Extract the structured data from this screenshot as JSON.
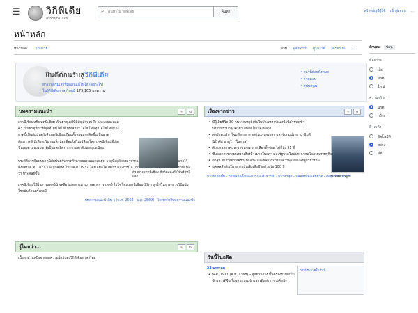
{
  "header": {
    "menu_icon": "menu-icon",
    "logo_title": "วิกิพีเดีย",
    "logo_tagline": "สารานุกรมเสรี",
    "search_placeholder": "ค้นหาใน วิกิพีเดีย",
    "search_button": "ค้นหา",
    "user_links": [
      "สร้างบัญชีผู้ใช้",
      "เข้าสู่ระบบ"
    ],
    "more_icon": "..."
  },
  "page": {
    "title": "หน้าหลัก",
    "tabs_left": [
      "หน้าหลัก",
      "อภิปราย"
    ],
    "tabs_right": [
      "อ่าน",
      "ดูต้นฉบับ",
      "ดูประวัติ",
      "เครื่องมือ"
    ]
  },
  "sidebar": {
    "title": "ลักษณะ",
    "hide": "ซ่อน",
    "groups": [
      {
        "label": "ข้อความ",
        "options": [
          "เล็ก",
          "ปกติ",
          "ใหญ่"
        ],
        "selected": 1
      },
      {
        "label": "ความกว้าง",
        "options": [
          "ปกติ",
          "กว้าง"
        ],
        "selected": 0
      },
      {
        "label": "สี (เบต้า)",
        "options": [
          "อัตโนมัติ",
          "สว่าง",
          "มืด"
        ],
        "selected": 1
      }
    ]
  },
  "welcome": {
    "title_prefix": "ยินดีต้อนรับสู่",
    "title_link": "วิกิพีเดีย",
    "line1": "สารานุกรมเสรีที่ทุกคนแก้ไขได้ (อย่างไร)",
    "line2": "ในวิกิพีเดียภาษาไทยมี",
    "count": "179,165 บทความ",
    "links": [
      "สถานีย่อยทั้งหมด",
      "ถามตอบ",
      "สนับสนุน"
    ]
  },
  "featured": {
    "title": "บทความแนะนำ",
    "para1": "เทคนีเชียมหรือเทคนีเชียม เป็นธาตุเคมีที่มีสัญลักษณ์ Tc และเลขอะตอม 43 เป็นธาตุที่เบาที่สุดที่ไม่มีไอโซโทปเสถียร ไอโซโทปทุกไอโซโทปของธาตุนี้เป็นกัมมันตรังสี เทคนีเชียมเกือบทั้งหมดถูกผลิตขึ้นเป็นธาตุสังเคราะห์ มีเพียงปริมาณเล็กน้อยที่พบได้ในเปลือกโลก เทคนีเชียมที่เกิดขึ้นเองตามธรรมชาติเป็นผลผลิตจากการแตกตัวของยูเรเนียม",
    "caption": "ตัวอย่าง เทคนีเชียม ที่สกัดและทำให้บริสุทธิ์แล้ว",
    "para2": "ประวัติการค้นพบธาตุนี้สัมพันธ์กับการทำนายของเมนเดเลเยฟ ธาตุที่อยู่ถัดลงมาจากแมงกานีสในตารางธาตุถูกทำนายไว้ตั้งแต่ปี ค.ศ. 1871 และถูกค้นพบในปี ค.ศ. 1937 โดยเอมีลีโอ เซเกร และการ์โล แปริเอร์ จึงได้ชื่อมาจากภาษากรีกที่แปลว่า ประดิษฐ์ขึ้น",
    "para3": "เทคนีเชียมใช้ในการแพทย์นิวเคลียร์และการถ่ายภาพทางการแพทย์ ไอโซโทปเทคนีเชียม-99m ถูกใช้ในการตรวจวินิจฉัยโรคนับล้านครั้งต่อปี",
    "footer_links": "บทความแนะนำอื่น ๆ (พ.ศ. 2568 - พ.ศ. 2569) - ไดเรกทอรีบทความแนะนำ"
  },
  "didyouknow": {
    "title": "รู้ไหมว่า...",
    "text": "เนื้อหาส่วนหนึ่งจากบทความใหม่ของวิกิพีเดียภาษาไทย"
  },
  "news": {
    "title": "เรื่องจากข่าว",
    "items": [
      "มีผู้เสียชีวิต 30 คนจากเหตุยิงกันในประเทศ ก่อนหน้านี้ตำรวจเข้าปราบปรามกลุ่มค้ายาเสพติดในเมืองหลวง",
      "สหรัฐอเมริกาโจมตีทางอากาศต่อเวเนซุเอลา และจับกุมประธานาธิบดีนิโกลัส มาดูโร (ในภาพ)",
      "ตัวแทนพรรคประชาชนชนะการเลือกตั้งซ่อม ได้ที่นั่ง 91 ที่",
      "ชีเคเอกราชกลุ่มพรรคเสียงข้างมากในสภา และรัฐบาลใหม่ประกาศนโยบายเศรษฐกิจ",
      "อาสุจิ สำรวจดาวเคราะห์แคระ และผลการสำรวจดาวพุธเผยแพร่สู่สาธารณะ",
      "บุคคลสำคัญในวงการบันเทิงเสียชีวิตด้วยวัย 100 ปี"
    ],
    "photo_caption": "นิโคลัส มาดูโร",
    "footer": "ข่าวที่เกิดขึ้น - การเลือกตั้งและการลงประชามติ - ข่าวล่าสุด - บุคคลที่เพิ่งเสียชีวิต - เหตุการณ์ปัจจุบัน"
  },
  "onthisday": {
    "title": "วันนี้ในอดีต",
    "date": "23 มกราคม",
    "items": [
      "พ.ศ. 1911 (ค.ศ. 1368) – จูหยวนจาง ขึ้นครองราชย์เป็นจักรพรรดิจีน ในฐานะปฐมจักรพรรดิแห่งราชวงศ์หมิง"
    ],
    "img_caption": "การประกาศในวันนี้"
  }
}
